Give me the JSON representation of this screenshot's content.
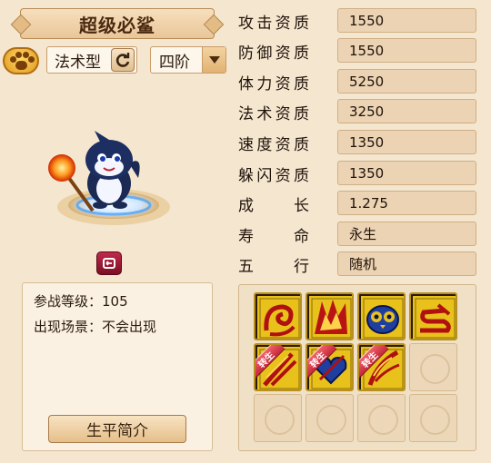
{
  "pet": {
    "name": "超级必鲨",
    "type": "法术型",
    "stage": "四阶",
    "battle_level": "参战等级：105",
    "scene": "出现场景：不会出现",
    "bio_button": "生平简介"
  },
  "attributes": [
    {
      "label": [
        "攻",
        "击",
        "资",
        "质"
      ],
      "value": "1550"
    },
    {
      "label": [
        "防",
        "御",
        "资",
        "质"
      ],
      "value": "1550"
    },
    {
      "label": [
        "体",
        "力",
        "资",
        "质"
      ],
      "value": "5250"
    },
    {
      "label": [
        "法",
        "术",
        "资",
        "质"
      ],
      "value": "3250"
    },
    {
      "label": [
        "速",
        "度",
        "资",
        "质"
      ],
      "value": "1350"
    },
    {
      "label": [
        "躲",
        "闪",
        "资",
        "质"
      ],
      "value": "1350"
    },
    {
      "label": [
        "成",
        "长"
      ],
      "value": "1.275"
    },
    {
      "label": [
        "寿",
        "命"
      ],
      "value": "永生"
    },
    {
      "label": [
        "五",
        "行"
      ],
      "value": "随机"
    }
  ],
  "skills": {
    "ribbon_text": "转生",
    "slots": [
      {
        "icon": "red-swirl-skill-icon",
        "filled": true,
        "reborn": false
      },
      {
        "icon": "red-flame-skill-icon",
        "filled": true,
        "reborn": false
      },
      {
        "icon": "blue-owl-skill-icon",
        "filled": true,
        "reborn": false
      },
      {
        "icon": "red-scroll-skill-icon",
        "filled": true,
        "reborn": false
      },
      {
        "icon": "red-blades-skill-icon",
        "filled": true,
        "reborn": true
      },
      {
        "icon": "blue-heart-skill-icon",
        "filled": true,
        "reborn": true
      },
      {
        "icon": "red-feather-skill-icon",
        "filled": true,
        "reborn": true
      },
      {
        "icon": "empty-slot",
        "filled": false,
        "reborn": false
      },
      {
        "icon": "empty-slot",
        "filled": false,
        "reborn": false
      },
      {
        "icon": "empty-slot",
        "filled": false,
        "reborn": false
      },
      {
        "icon": "empty-slot",
        "filled": false,
        "reborn": false
      },
      {
        "icon": "empty-slot",
        "filled": false,
        "reborn": false
      }
    ]
  },
  "colors": {
    "background": "#f4e6cf",
    "value_box": "#ecd3b3",
    "skill_gold": "#e8c21a",
    "skill_red": "#c4181c",
    "ribbon": "#d83444"
  }
}
